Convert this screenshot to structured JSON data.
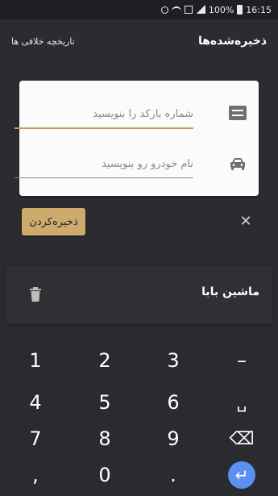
{
  "status_bar": {
    "battery_text": "100%",
    "time": "16:15"
  },
  "app_bar": {
    "title": "ذخیره‌شده‌ها",
    "history_link": "تاریخچه خلافی ها"
  },
  "form": {
    "barcode_placeholder": "شماره بارکد را بنویسید",
    "barcode_value": "",
    "car_name_placeholder": "نام خودرو رو بنویسید",
    "car_name_value": "",
    "save_label": "ذخیره‌کردن",
    "accent_color": "#cfaa6d"
  },
  "saved_items": [
    {
      "name": "ماشین بابا"
    }
  ],
  "keyboard": {
    "rows": [
      [
        "1",
        "2",
        "3",
        "–"
      ],
      [
        "4",
        "5",
        "6",
        "␣"
      ],
      [
        "7",
        "8",
        "9",
        "⌫"
      ],
      [
        ",",
        "0",
        ".",
        "↵"
      ]
    ]
  }
}
